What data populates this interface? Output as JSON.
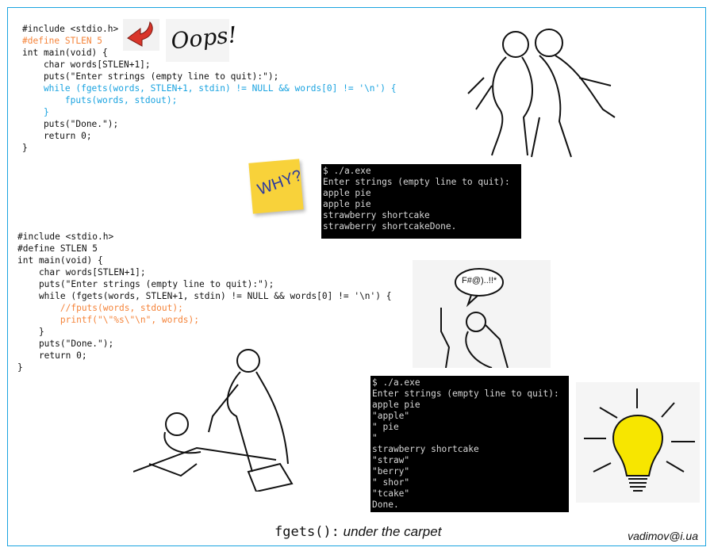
{
  "colors": {
    "orange": "#f5843a",
    "blue": "#1aa3e0",
    "frame": "#1aa3e0",
    "terminal_bg": "#000000"
  },
  "code1": {
    "lines": [
      {
        "text": "#include <stdio.h>",
        "color": ""
      },
      {
        "text": "#define STLEN 5",
        "color": "orange"
      },
      {
        "text": "int main(void) {",
        "color": ""
      },
      {
        "text": "    char words[STLEN+1];",
        "color": ""
      },
      {
        "text": "    puts(\"Enter strings (empty line to quit):\");",
        "color": ""
      },
      {
        "text": "    while (fgets(words, STLEN+1, stdin) != NULL && words[0] != '\\n') {",
        "color": "blue"
      },
      {
        "text": "        fputs(words, stdout);",
        "color": "blue"
      },
      {
        "text": "    }",
        "color": "blue"
      },
      {
        "text": "    puts(\"Done.\");",
        "color": ""
      },
      {
        "text": "    return 0;",
        "color": ""
      },
      {
        "text": "}",
        "color": ""
      }
    ]
  },
  "code2": {
    "lines": [
      {
        "text": "#include <stdio.h>",
        "color": ""
      },
      {
        "text": "#define STLEN 5",
        "color": ""
      },
      {
        "text": "int main(void) {",
        "color": ""
      },
      {
        "text": "    char words[STLEN+1];",
        "color": ""
      },
      {
        "text": "    puts(\"Enter strings (empty line to quit):\");",
        "color": ""
      },
      {
        "text": "    while (fgets(words, STLEN+1, stdin) != NULL && words[0] != '\\n') {",
        "color": ""
      },
      {
        "text": "        //fputs(words, stdout);",
        "color": "orange"
      },
      {
        "text": "        printf(\"\\\"%s\\\"\\n\", words);",
        "color": "orange"
      },
      {
        "text": "    }",
        "color": ""
      },
      {
        "text": "    puts(\"Done.\");",
        "color": ""
      },
      {
        "text": "    return 0;",
        "color": ""
      },
      {
        "text": "}",
        "color": ""
      }
    ]
  },
  "terminal1": {
    "lines": [
      "$ ./a.exe",
      "Enter strings (empty line to quit):",
      "apple pie",
      "apple pie",
      "strawberry shortcake",
      "strawberry shortcakeDone."
    ]
  },
  "terminal2": {
    "lines": [
      "$ ./a.exe",
      "Enter strings (empty line to quit):",
      "apple pie",
      "\"apple\"",
      "\" pie",
      "\"",
      "strawberry shortcake",
      "\"straw\"",
      "\"berry\"",
      "\" shor\"",
      "\"tcake\"",
      "Done."
    ]
  },
  "stickers": {
    "oops": "Oops!",
    "why": "WHY?",
    "curse": "F#@)..!!*"
  },
  "caption": {
    "function": "fgets():",
    "subtitle": " under the  carpet"
  },
  "author": "vadimov@i.ua"
}
